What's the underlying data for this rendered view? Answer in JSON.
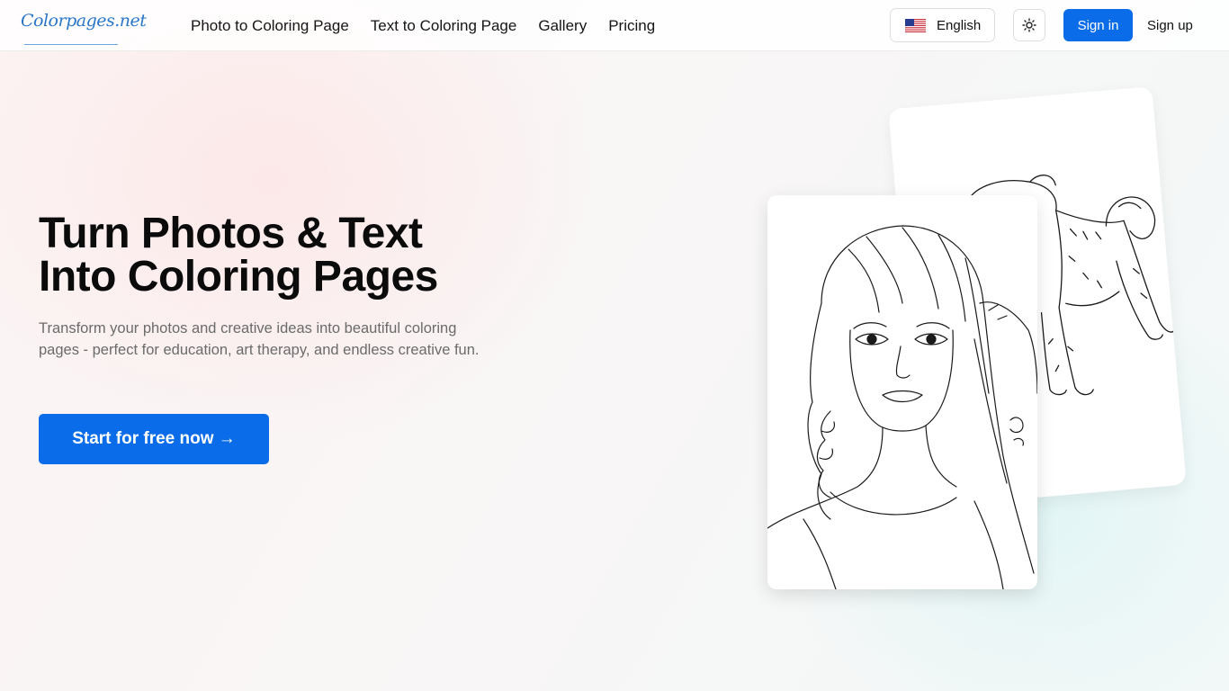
{
  "logo": {
    "text": "Colorpages.net"
  },
  "nav": {
    "links": [
      {
        "label": "Photo to Coloring Page"
      },
      {
        "label": "Text to Coloring Page"
      },
      {
        "label": "Gallery"
      },
      {
        "label": "Pricing"
      }
    ],
    "language": {
      "label": "English",
      "flag_icon": "us-flag-icon"
    },
    "theme_icon": "sun-icon",
    "sign_in": "Sign in",
    "sign_up": "Sign up"
  },
  "hero": {
    "title_line1": "Turn Photos & Text",
    "title_line2": "Into Coloring Pages",
    "subtitle_line1": "Transform your photos and creative ideas into beautiful coloring",
    "subtitle_line2": "pages - perfect for education, art therapy, and endless creative fun.",
    "cta": "Start for free now →"
  },
  "colors": {
    "primary": "#0a6ce8",
    "text_dark": "#0b0b0b",
    "text_muted": "#6b6b6b",
    "logo_blue": "#2a76c9"
  },
  "images": [
    {
      "icon": "dog-coloring-page-illustration"
    },
    {
      "icon": "girl-portrait-coloring-page-illustration"
    }
  ]
}
